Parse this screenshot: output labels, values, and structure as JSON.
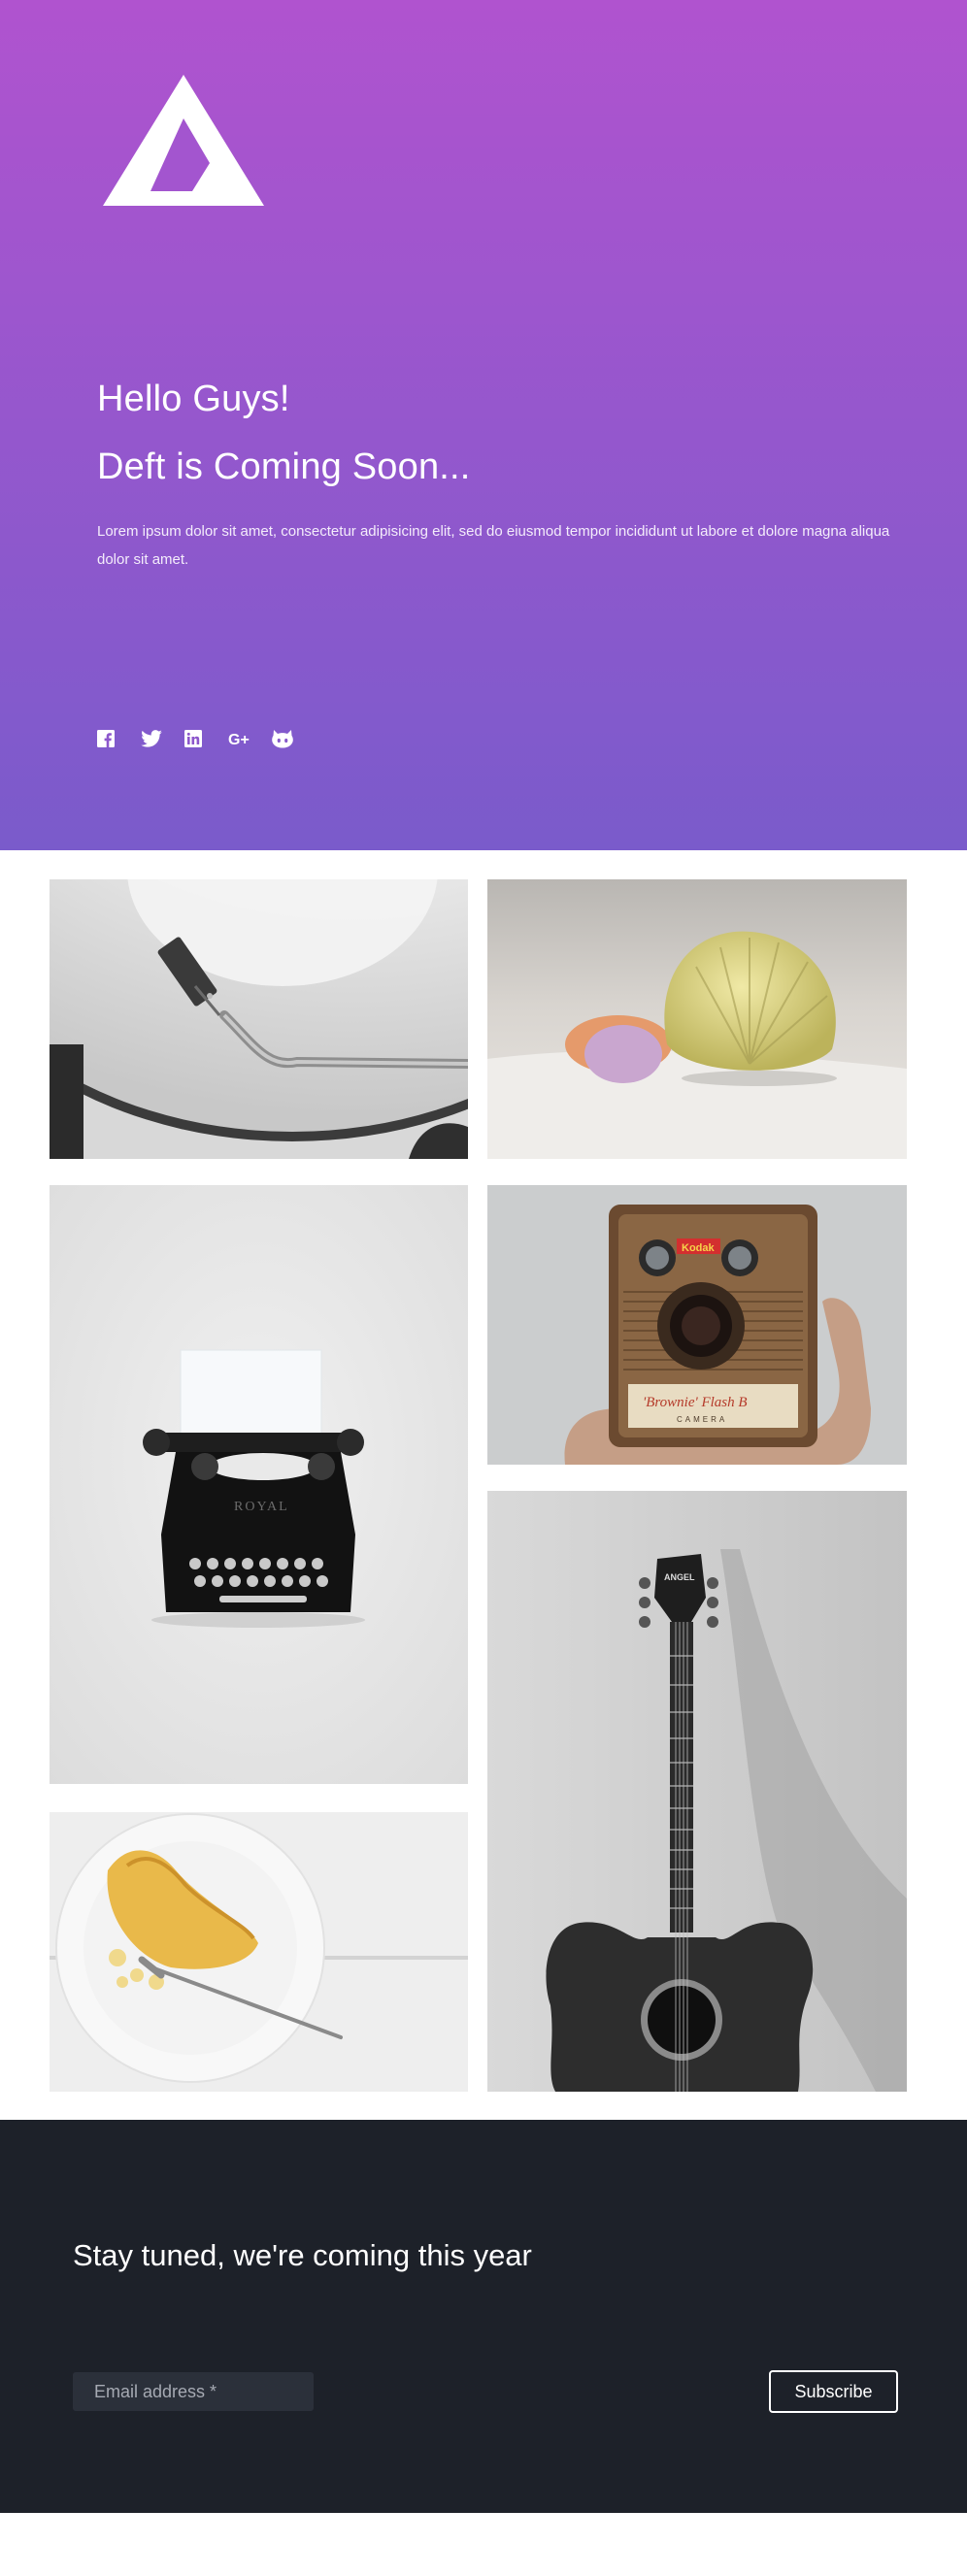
{
  "hero": {
    "greeting": "Hello Guys!",
    "headline": "Deft is Coming Soon...",
    "description": "Lorem ipsum dolor sit amet, consectetur adipisicing elit, sed do eiusmod tempor incididunt ut labore et dolore magna aliqua dolor sit amet.",
    "gradient_top": "#b053cf",
    "gradient_bottom": "#7a5bcb",
    "socials": [
      {
        "name": "facebook-icon"
      },
      {
        "name": "twitter-icon"
      },
      {
        "name": "linkedin-icon"
      },
      {
        "name": "google-plus-icon"
      },
      {
        "name": "github-icon"
      }
    ]
  },
  "gallery": {
    "photos": [
      {
        "name": "turntable-photo",
        "printed_text": ""
      },
      {
        "name": "seashell-photo",
        "printed_text": ""
      },
      {
        "name": "typewriter-photo",
        "printed_text": "ROYAL"
      },
      {
        "name": "camera-photo",
        "printed_text": "Kodak",
        "camera_caption": "Brownie Flash B",
        "camera_sub": "CAMERA"
      },
      {
        "name": "guitar-photo",
        "printed_text": "ANGEL"
      },
      {
        "name": "cake-photo",
        "printed_text": ""
      }
    ]
  },
  "footer": {
    "title": "Stay tuned, we're coming this year",
    "email_placeholder": "Email address *",
    "subscribe_label": "Subscribe",
    "background": "#1d2129"
  }
}
